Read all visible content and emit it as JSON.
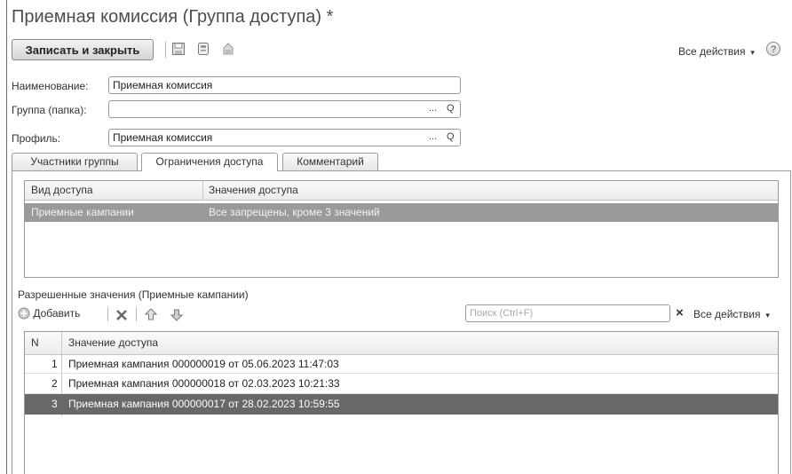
{
  "window": {
    "title": "Приемная комиссия (Группа доступа) *"
  },
  "toolbar": {
    "save_close_label": "Записать и закрыть",
    "all_actions_label": "Все действия",
    "help_label": "?",
    "icons": [
      "save-icon",
      "save-copy-icon",
      "post-icon"
    ]
  },
  "form": {
    "name_label": "Наименование:",
    "name_value": "Приемная комиссия",
    "group_label": "Группа (папка):",
    "group_value": "",
    "profile_label": "Профиль:",
    "profile_value": "Приемная комиссия",
    "select_button": "...",
    "open_button": "Q"
  },
  "tabs": [
    {
      "label": "Участники группы"
    },
    {
      "label": "Ограничения доступа"
    },
    {
      "label": "Комментарий"
    }
  ],
  "access_table": {
    "columns": [
      "Вид доступа",
      "Значения доступа"
    ],
    "rows": [
      [
        "Приемные кампании",
        "Все запрещены, кроме 3 значений"
      ]
    ]
  },
  "allowed": {
    "title": "Разрешенные значения (Приемные кампании)",
    "add_label": "Добавить",
    "search_placeholder": "Поиск (Ctrl+F)",
    "clear_label": "×",
    "all_actions_label": "Все действия"
  },
  "values_table": {
    "columns": [
      "N",
      "Значение доступа"
    ],
    "rows": [
      [
        "1",
        "Приемная кампания 000000019 от 05.06.2023 11:47:03"
      ],
      [
        "2",
        "Приемная кампания 000000018 от 02.03.2023 10:21:33"
      ],
      [
        "3",
        "Приемная кампания 000000017 от 28.02.2023 10:59:55"
      ]
    ]
  },
  "colors": {
    "selection_light": "#9a9a9a",
    "selection_dark": "#686868"
  }
}
